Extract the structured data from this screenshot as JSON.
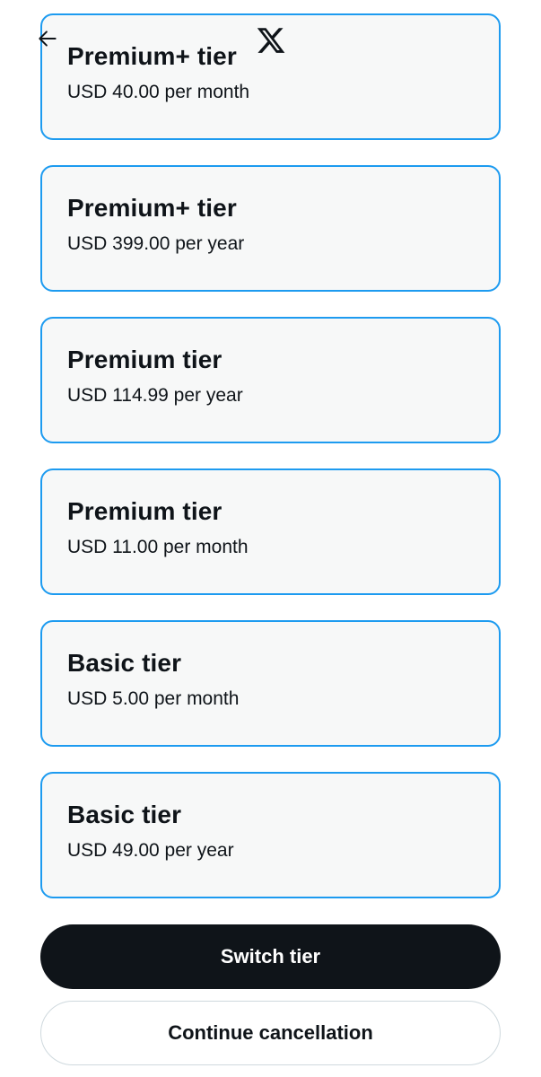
{
  "header": {
    "back_icon": "arrow-left-icon",
    "logo_icon": "x-logo-icon"
  },
  "tiers": [
    {
      "name": "Premium+ tier",
      "price": "USD 40.00 per month"
    },
    {
      "name": "Premium+ tier",
      "price": "USD 399.00 per year"
    },
    {
      "name": "Premium tier",
      "price": "USD 114.99 per year"
    },
    {
      "name": "Premium tier",
      "price": "USD 11.00 per month"
    },
    {
      "name": "Basic tier",
      "price": "USD 5.00 per month"
    },
    {
      "name": "Basic tier",
      "price": "USD 49.00 per year"
    }
  ],
  "actions": {
    "switch_label": "Switch tier",
    "cancel_label": "Continue cancellation"
  },
  "colors": {
    "accent_border": "#1d9bf0",
    "card_background": "#f7f8f8",
    "primary_button": "#0f1419",
    "text": "#0f1419"
  }
}
